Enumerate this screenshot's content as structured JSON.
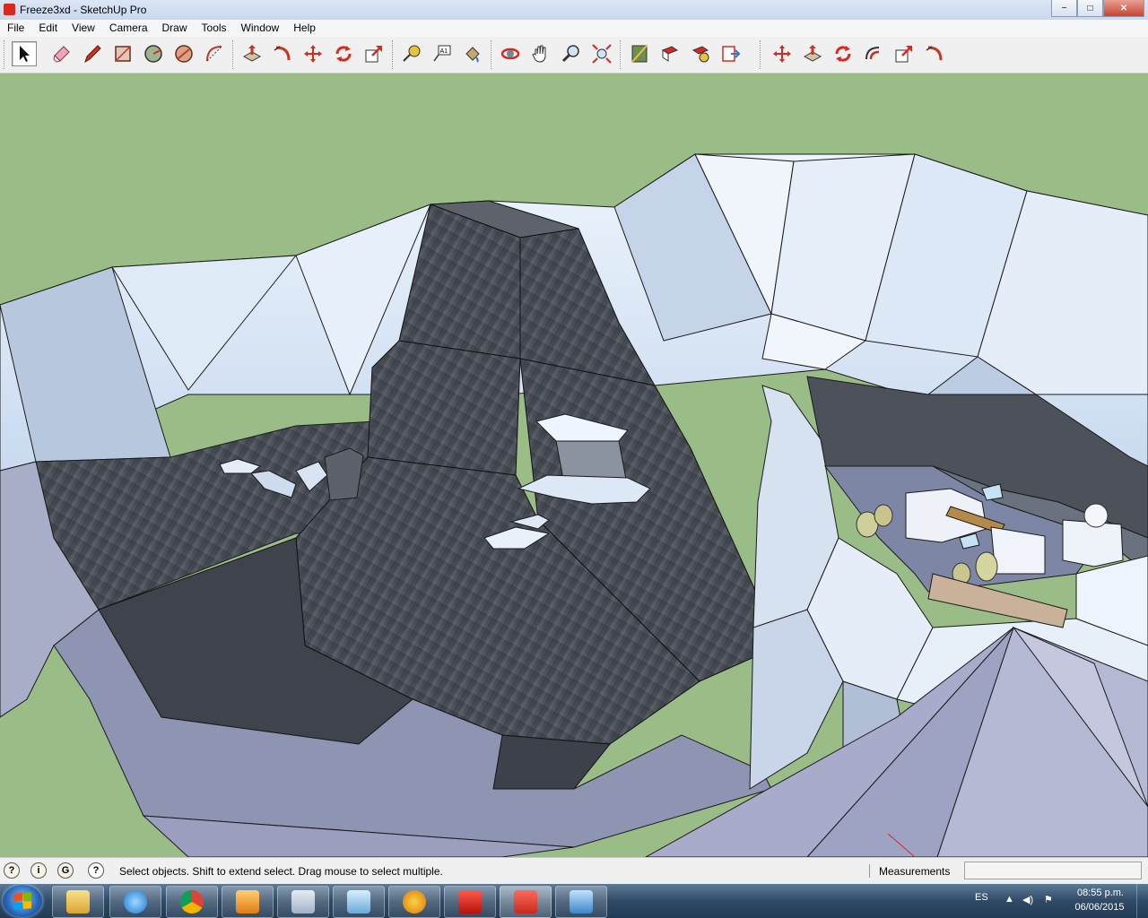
{
  "window": {
    "title": "Freeze3xd - SketchUp Pro",
    "minimize_glyph": "−",
    "maximize_glyph": "□",
    "close_glyph": "✕"
  },
  "menu": {
    "items": [
      "File",
      "Edit",
      "View",
      "Camera",
      "Draw",
      "Tools",
      "Window",
      "Help"
    ]
  },
  "toolbar": {
    "active_tool": "select-tool",
    "tools": [
      "select-tool-icon",
      "eraser-tool-icon",
      "pencil-line-tool-icon",
      "rectangle-tool-icon",
      "circle-tool-icon",
      "polygon-tool-icon",
      "arc-tool-icon",
      "push-pull-tool-icon",
      "follow-me-tool-icon",
      "move-tool-icon",
      "rotate-tool-icon",
      "scale-tool-icon",
      "tape-measure-tool-icon",
      "text-tool-icon",
      "paint-bucket-tool-icon",
      "orbit-tool-icon",
      "pan-tool-icon",
      "zoom-tool-icon",
      "zoom-extents-tool-icon",
      "map-location-icon",
      "get-models-icon",
      "share-model-icon",
      "send-to-layout-icon",
      "move-tool-2-icon",
      "push-pull-tool-2-icon",
      "rotate-tool-2-icon",
      "offset-tool-icon",
      "scale-tool-2-icon",
      "follow-me-tool-2-icon"
    ]
  },
  "viewport": {
    "background_color": "#9abd88",
    "model_name": "Freeze3xd"
  },
  "status": {
    "icons": [
      "geolocation-icon",
      "credits-icon",
      "sign-in-icon",
      "help-icon"
    ],
    "message": "Select objects. Shift to extend select. Drag mouse to select multiple.",
    "measurements_label": "Measurements",
    "measurements_value": ""
  },
  "taskbar": {
    "apps": [
      "file-explorer-icon",
      "internet-explorer-icon",
      "chrome-icon",
      "media-player-icon",
      "calculator-icon",
      "notepad-icon",
      "audio-editor-icon",
      "adobe-reader-icon",
      "sketchup-icon",
      "control-panel-icon"
    ],
    "language": "ES",
    "time": "08:55 p.m.",
    "date": "06/06/2015"
  },
  "colors": {
    "accent_red": "#d9281e",
    "sky_green": "#9abd88",
    "rock_dark": "#4b5058",
    "ice_light": "#dbe8f6",
    "ground_purple": "#9c9ebd"
  }
}
